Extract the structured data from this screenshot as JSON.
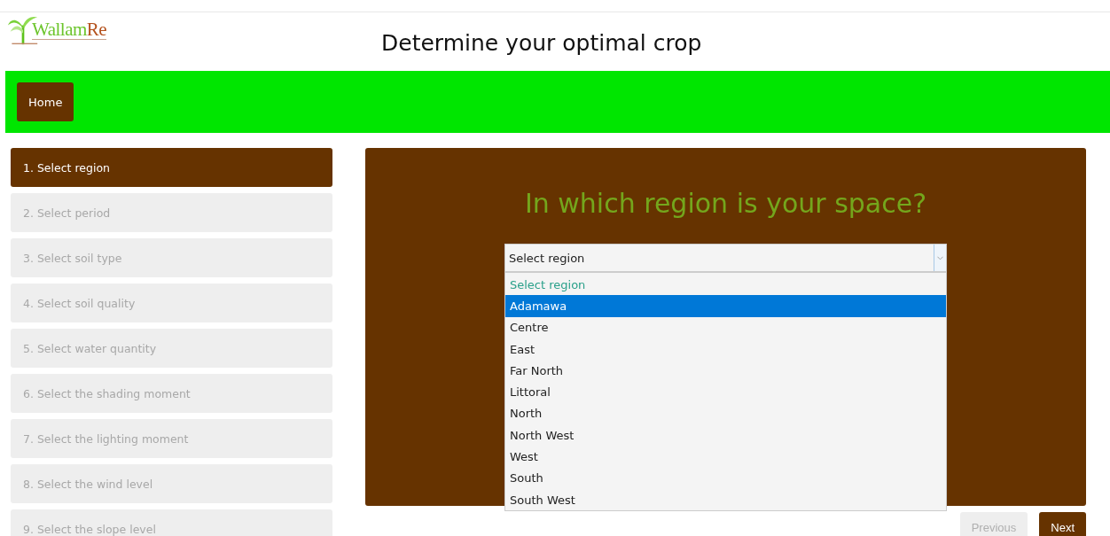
{
  "logo": {
    "parts": [
      "Wallam",
      "Re"
    ]
  },
  "page_title": "Determine your optimal crop",
  "nav": [
    {
      "label": "Home"
    }
  ],
  "steps": [
    {
      "label": "1. Select region",
      "selected": true
    },
    {
      "label": "2. Select period",
      "selected": false
    },
    {
      "label": "3. Select soil type",
      "selected": false
    },
    {
      "label": "4. Select soil quality",
      "selected": false
    },
    {
      "label": "5. Select water quantity",
      "selected": false
    },
    {
      "label": "6. Select the shading moment",
      "selected": false
    },
    {
      "label": "7. Select the lighting moment",
      "selected": false
    },
    {
      "label": "8. Select the wind level",
      "selected": false
    },
    {
      "label": "9. Select the slope level",
      "selected": false
    }
  ],
  "question": "In which region is your space?",
  "region_select": {
    "value": "Select region",
    "expanded": true,
    "options": [
      {
        "label": "Select region",
        "selected": true,
        "highlighted": false
      },
      {
        "label": "Adamawa",
        "selected": false,
        "highlighted": true
      },
      {
        "label": "Centre",
        "selected": false,
        "highlighted": false
      },
      {
        "label": "East",
        "selected": false,
        "highlighted": false
      },
      {
        "label": "Far North",
        "selected": false,
        "highlighted": false
      },
      {
        "label": "Littoral",
        "selected": false,
        "highlighted": false
      },
      {
        "label": "North",
        "selected": false,
        "highlighted": false
      },
      {
        "label": "North West",
        "selected": false,
        "highlighted": false
      },
      {
        "label": "West",
        "selected": false,
        "highlighted": false
      },
      {
        "label": "South",
        "selected": false,
        "highlighted": false
      },
      {
        "label": "South West",
        "selected": false,
        "highlighted": false
      }
    ]
  },
  "buttons": [
    {
      "label": "Previous",
      "disabled": true
    },
    {
      "label": "Next",
      "disabled": false
    }
  ]
}
